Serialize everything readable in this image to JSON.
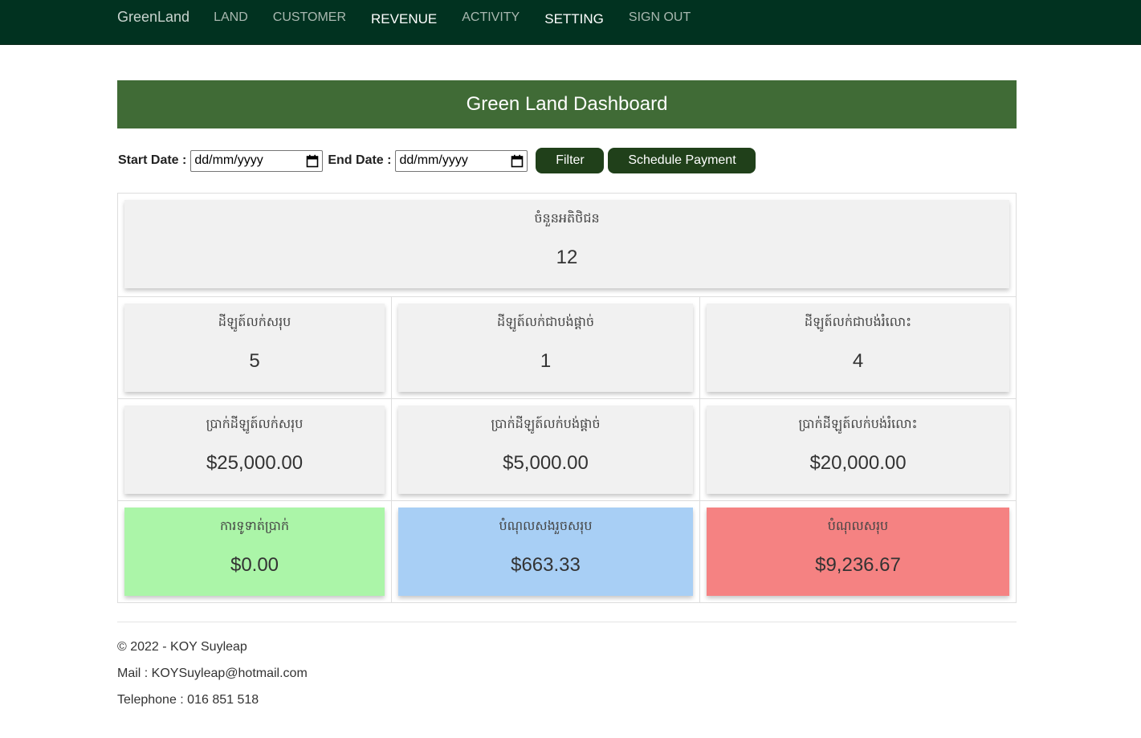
{
  "nav": {
    "brand": "GreenLand",
    "items": [
      {
        "label": "LAND"
      },
      {
        "label": "CUSTOMER"
      },
      {
        "label": "REVENUE"
      },
      {
        "label": "ACTIVITY"
      },
      {
        "label": "SETTING"
      },
      {
        "label": "SIGN OUT"
      }
    ]
  },
  "dashboard": {
    "title": "Green Land Dashboard"
  },
  "filter": {
    "start_label": "Start Date :",
    "start_placeholder": "dd/mm/yyyy",
    "end_label": "End Date :",
    "end_placeholder": "dd/mm/yyyy",
    "filter_button": "Filter",
    "schedule_button": "Schedule Payment"
  },
  "stats": {
    "customers": {
      "label": "ចំនួនអតិថិជន",
      "value": "12"
    },
    "land_total": {
      "label": "ដីឡូត៍លក់សរុប",
      "value": "5"
    },
    "land_full": {
      "label": "ដីឡូត៍លក់ជាបង់ផ្តាច់",
      "value": "1"
    },
    "land_installment": {
      "label": "ដីឡូត៍លក់ជាបង់រំលោះ",
      "value": "4"
    },
    "money_total": {
      "label": "ប្រាក់ដីឡូត៍លក់សរុប",
      "value": "$25,000.00"
    },
    "money_full": {
      "label": "ប្រាក់ដីឡូត៍លក់បង់ផ្តាច់",
      "value": "$5,000.00"
    },
    "money_installment": {
      "label": "ប្រាក់ដីឡូត៍លក់បង់រំលោះ",
      "value": "$20,000.00"
    },
    "received": {
      "label": "ការទូទាត់ប្រាក់",
      "value": "$0.00",
      "color": "#abf5a8"
    },
    "paid_debt": {
      "label": "បំណុលសងរួចសរុប",
      "value": "$663.33",
      "color": "#a8cff5"
    },
    "remaining_debt": {
      "label": "បំណុលសរុប",
      "value": "$9,236.67",
      "color": "#f58282"
    }
  },
  "footer": {
    "copyright": "© 2022 - KOY Suyleap",
    "mail": "Mail : KOYSuyleap@hotmail.com",
    "telephone": "Telephone : 016 851 518"
  },
  "colors": {
    "navbar": "#013220",
    "title_bar": "#406b36",
    "button": "#20401a"
  }
}
